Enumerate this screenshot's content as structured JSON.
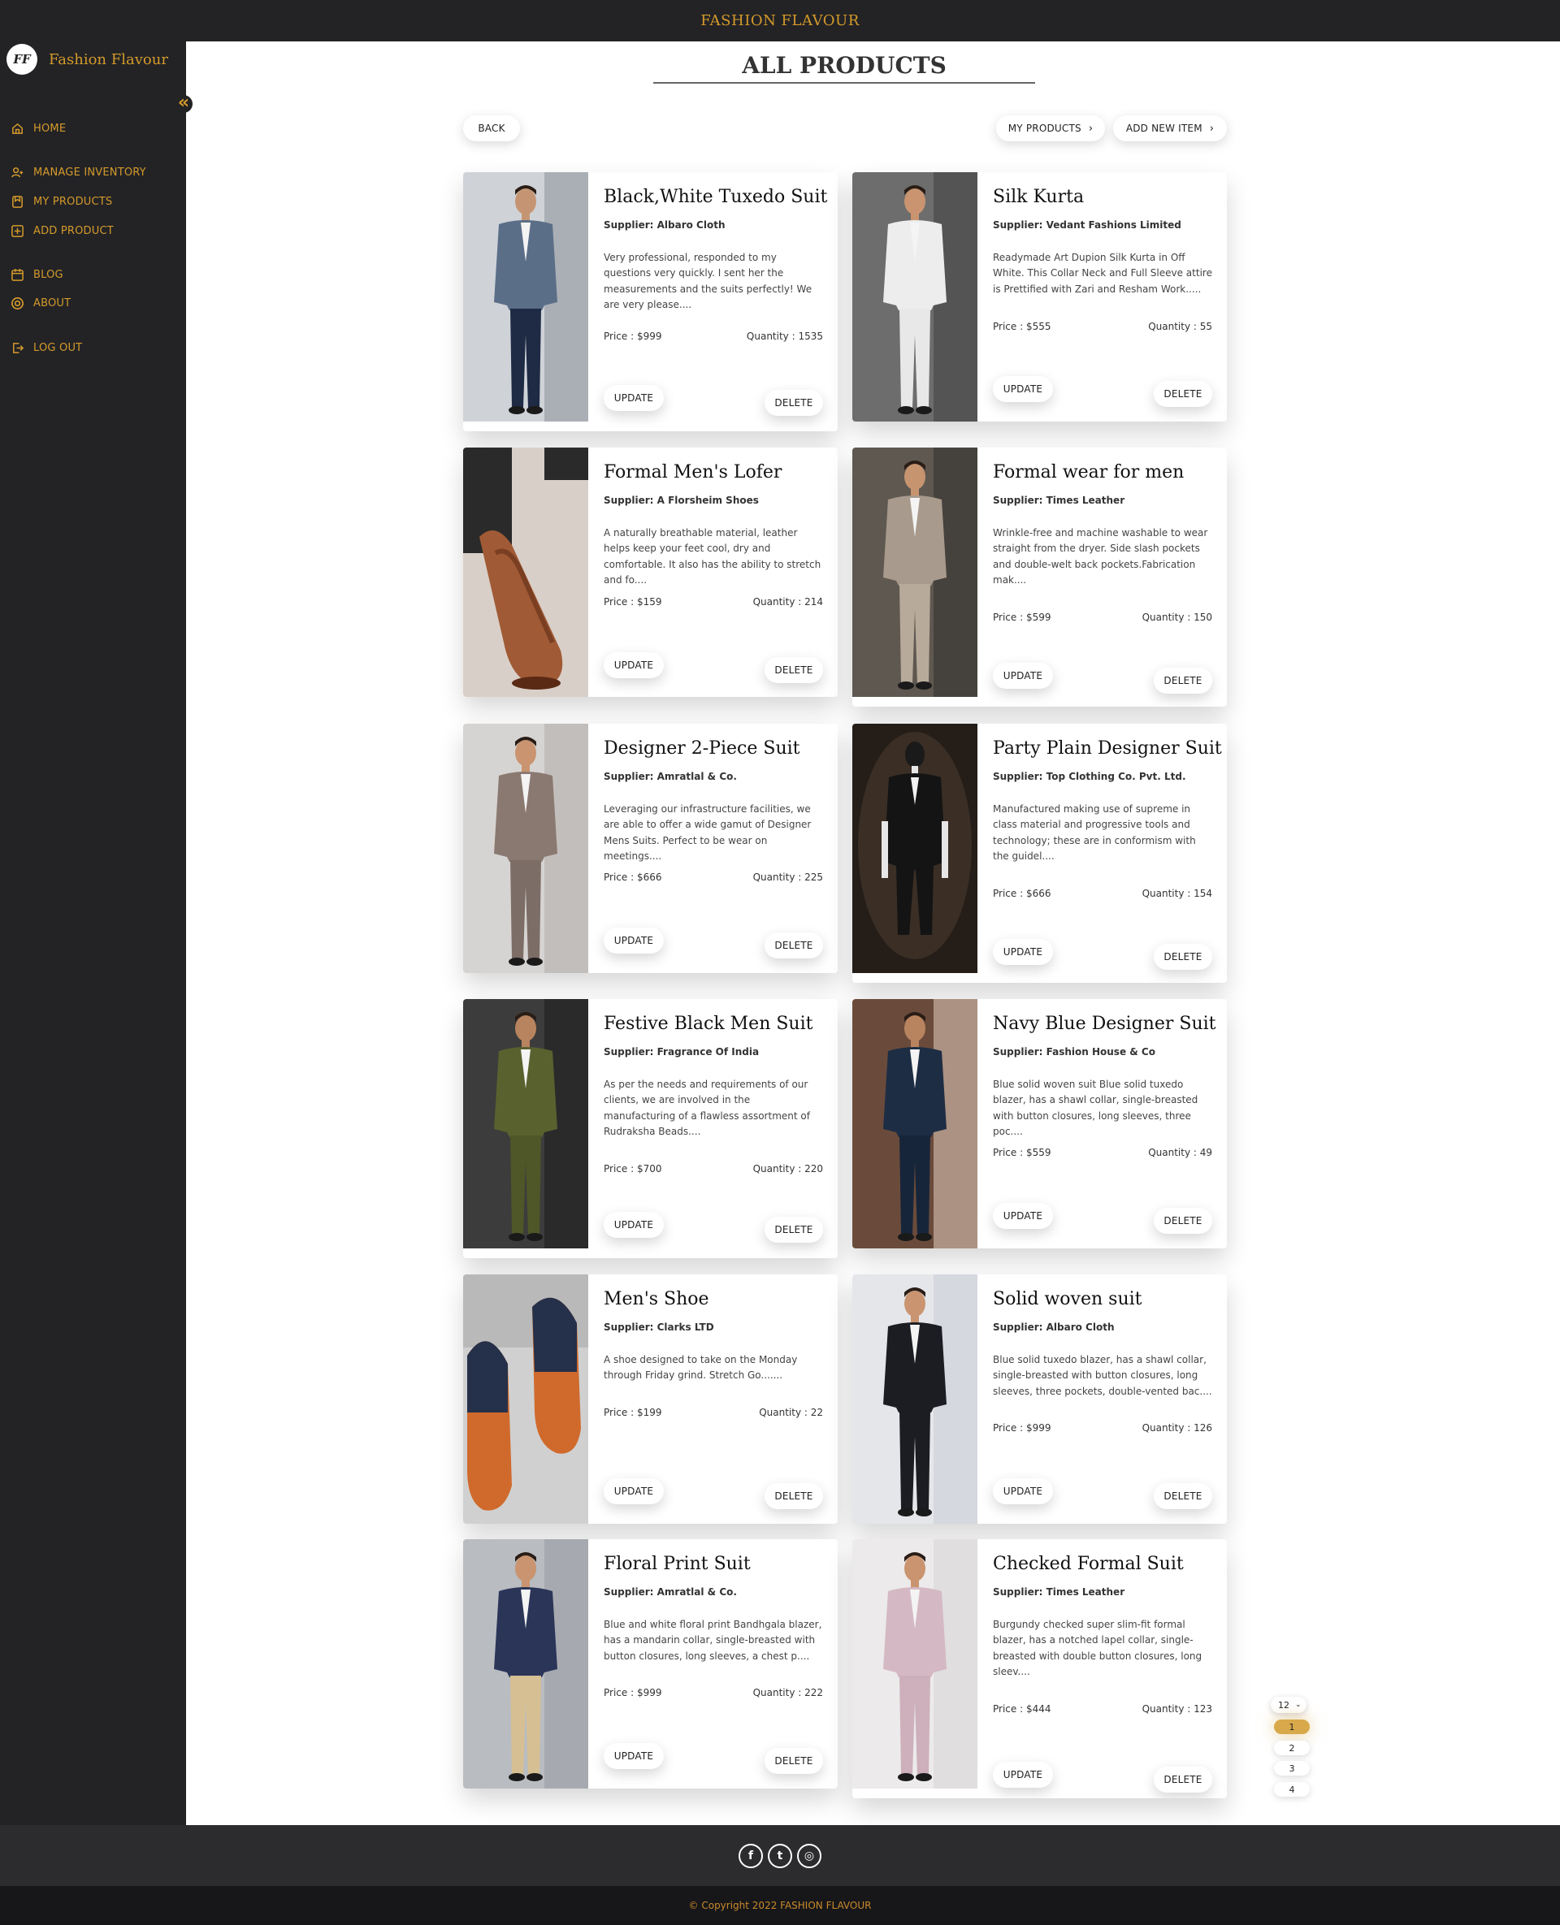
{
  "topbar": {
    "title": "FASHION FLAVOUR"
  },
  "brand": {
    "logo_text": "FF",
    "name": "Fashion Flavour"
  },
  "sidebar": {
    "collapse_glyph": "«",
    "items": [
      {
        "label": "HOME",
        "icon": "home-icon"
      },
      {
        "label": "MANAGE INVENTORY",
        "icon": "users-icon"
      },
      {
        "label": "MY PRODUCTS",
        "icon": "bookmark-icon"
      },
      {
        "label": "ADD PRODUCT",
        "icon": "plus-square-icon"
      },
      {
        "label": "BLOG",
        "icon": "calendar-icon"
      },
      {
        "label": "ABOUT",
        "icon": "target-icon"
      },
      {
        "label": "LOG OUT",
        "icon": "logout-icon"
      }
    ]
  },
  "header": {
    "title": "ALL PRODUCTS",
    "back_label": "BACK",
    "my_products_label": "MY PRODUCTS",
    "add_new_label": "ADD NEW ITEM"
  },
  "card_labels": {
    "update": "UPDATE",
    "delete": "DELETE"
  },
  "products": [
    {
      "name": "Black,White Tuxedo Suit",
      "supplier": "Supplier: Albaro Cloth",
      "description": "Very professional, responded to my questions very quickly. I sent her the measurements and the suits perfectly! We are very please....",
      "price": "Price : $999",
      "quantity": "Quantity : 1535"
    },
    {
      "name": "Silk Kurta",
      "supplier": "Supplier: Vedant Fashions Limited",
      "description": "Readymade Art Dupion Silk Kurta in Off White. This Collar Neck and Full Sleeve attire is Prettified with Zari and Resham Work.....",
      "price": "Price : $555",
      "quantity": "Quantity : 55"
    },
    {
      "name": "Formal Men's Lofer",
      "supplier": "Supplier: A Florsheim Shoes",
      "description": "A naturally breathable material, leather helps keep your feet cool, dry and comfortable. It also has the ability to stretch and fo....",
      "price": "Price : $159",
      "quantity": "Quantity : 214"
    },
    {
      "name": "Formal wear for men",
      "supplier": "Supplier: Times Leather",
      "description": "Wrinkle-free and machine washable to wear straight from the dryer. Side slash pockets and double-welt back pockets.Fabrication mak....",
      "price": "Price : $599",
      "quantity": "Quantity : 150"
    },
    {
      "name": "Designer 2-Piece Suit",
      "supplier": "Supplier: Amratlal & Co.",
      "description": "Leveraging our infrastructure facilities, we are able to offer a wide gamut of Designer Mens Suits. Perfect to be wear on meetings....",
      "price": "Price : $666",
      "quantity": "Quantity : 225"
    },
    {
      "name": "Party Plain Designer Suit",
      "supplier": "Supplier: Top Clothing Co. Pvt. Ltd.",
      "description": "Manufactured making use of supreme in class material and progressive tools and technology; these are in conformism with the guidel....",
      "price": "Price : $666",
      "quantity": "Quantity : 154"
    },
    {
      "name": "Festive Black Men Suit",
      "supplier": "Supplier: Fragrance Of India",
      "description": "As per the needs and requirements of our clients, we are involved in the manufacturing of a flawless assortment of Rudraksha Beads....",
      "price": "Price : $700",
      "quantity": "Quantity : 220"
    },
    {
      "name": "Navy Blue Designer Suit",
      "supplier": "Supplier: Fashion House & Co",
      "description": "Blue solid woven suit Blue solid tuxedo blazer, has a shawl collar, single-breasted with button closures, long sleeves, three poc....",
      "price": "Price : $559",
      "quantity": "Quantity : 49"
    },
    {
      "name": "Men's Shoe",
      "supplier": "Supplier: Clarks LTD",
      "description": "A shoe designed to take on the Monday through Friday grind. Stretch Go.......",
      "price": "Price : $199",
      "quantity": "Quantity : 22"
    },
    {
      "name": "Solid woven suit",
      "supplier": "Supplier: Albaro Cloth",
      "description": "Blue solid tuxedo blazer, has a shawl collar, single-breasted with button closures, long sleeves, three pockets, double-vented bac....",
      "price": "Price : $999",
      "quantity": "Quantity : 126"
    },
    {
      "name": "Floral Print Suit",
      "supplier": "Supplier: Amratlal & Co.",
      "description": "Blue and white floral print Bandhgala blazer, has a mandarin collar, single-breasted with button closures, long sleeves, a chest p....",
      "price": "Price : $999",
      "quantity": "Quantity : 222"
    },
    {
      "name": "Checked Formal Suit",
      "supplier": "Supplier: Times Leather",
      "description": "Burgundy checked super slim-fit formal blazer, has a notched lapel collar, single-breasted with double button closures, long sleev....",
      "price": "Price : $444",
      "quantity": "Quantity : 123"
    }
  ],
  "pagination": {
    "page_size": "12",
    "pages": [
      "1",
      "2",
      "3",
      "4"
    ],
    "active_page": "1"
  },
  "footer": {
    "social": [
      {
        "glyph": "f",
        "icon": "facebook-icon"
      },
      {
        "glyph": "t",
        "icon": "twitter-icon"
      },
      {
        "glyph": "◎",
        "icon": "instagram-icon"
      }
    ],
    "copyright": "© Copyright 2022 FASHION FLAVOUR"
  },
  "colors": {
    "accent": "#d49a2a",
    "sidebar_bg": "#232326",
    "page_bg": "#ffffff",
    "active_page": "#d8a94a"
  }
}
